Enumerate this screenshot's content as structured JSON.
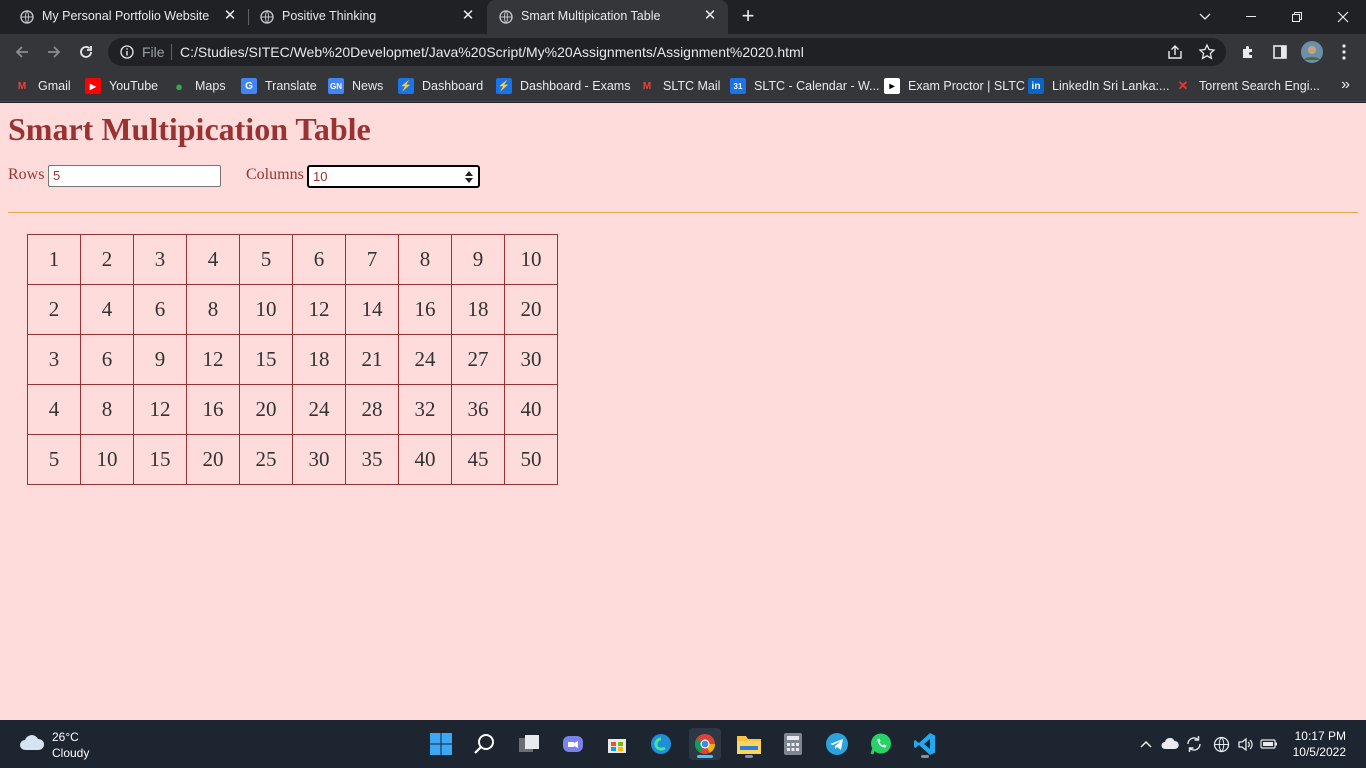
{
  "browser": {
    "tabs": [
      {
        "title": "My Personal Portfolio Website",
        "active": false
      },
      {
        "title": "Positive Thinking",
        "active": false
      },
      {
        "title": "Smart Multipication Table",
        "active": true
      }
    ],
    "address": {
      "scheme_label": "File",
      "url": "C:/Studies/SITEC/Web%20Developmet/Java%20Script/My%20Assignments/Assignment%2020.html"
    },
    "bookmarks": [
      {
        "label": "Gmail",
        "icon": "gmail-icon"
      },
      {
        "label": "YouTube",
        "icon": "youtube-icon"
      },
      {
        "label": "Maps",
        "icon": "maps-icon"
      },
      {
        "label": "Translate",
        "icon": "translate-icon"
      },
      {
        "label": "News",
        "icon": "news-icon"
      },
      {
        "label": "Dashboard",
        "icon": "dashboard-icon"
      },
      {
        "label": "Dashboard - Exams",
        "icon": "dashboard-icon"
      },
      {
        "label": "SLTC Mail",
        "icon": "gmail-icon"
      },
      {
        "label": "SLTC - Calendar - W...",
        "icon": "calendar-icon"
      },
      {
        "label": "Exam Proctor | SLTC",
        "icon": "proctor-icon"
      },
      {
        "label": "LinkedIn Sri Lanka:...",
        "icon": "linkedin-icon"
      },
      {
        "label": "Torrent Search Engi...",
        "icon": "torrent-icon"
      }
    ],
    "bookmarks_overflow": "»"
  },
  "page": {
    "heading": "Smart Multipication Table",
    "rows_label": "Rows",
    "rows_value": "5",
    "columns_label": "Columns",
    "columns_value": "10",
    "table": [
      [
        "1",
        "2",
        "3",
        "4",
        "5",
        "6",
        "7",
        "8",
        "9",
        "10"
      ],
      [
        "2",
        "4",
        "6",
        "8",
        "10",
        "12",
        "14",
        "16",
        "18",
        "20"
      ],
      [
        "3",
        "6",
        "9",
        "12",
        "15",
        "18",
        "21",
        "24",
        "27",
        "30"
      ],
      [
        "4",
        "8",
        "12",
        "16",
        "20",
        "24",
        "28",
        "32",
        "36",
        "40"
      ],
      [
        "5",
        "10",
        "15",
        "20",
        "25",
        "30",
        "35",
        "40",
        "45",
        "50"
      ]
    ],
    "colors": {
      "text": "#993333",
      "background": "#ffdcdc",
      "rule": "#e6a64d"
    }
  },
  "taskbar": {
    "weather": {
      "temp": "26°C",
      "condition": "Cloudy"
    },
    "apps": [
      "start-icon",
      "search-icon",
      "task-view-icon",
      "teams-icon",
      "store-icon",
      "edge-icon",
      "chrome-icon",
      "file-explorer-icon",
      "calculator-icon",
      "telegram-icon",
      "whatsapp-icon",
      "vscode-icon"
    ],
    "clock": {
      "time": "10:17 PM",
      "date": "10/5/2022"
    }
  }
}
